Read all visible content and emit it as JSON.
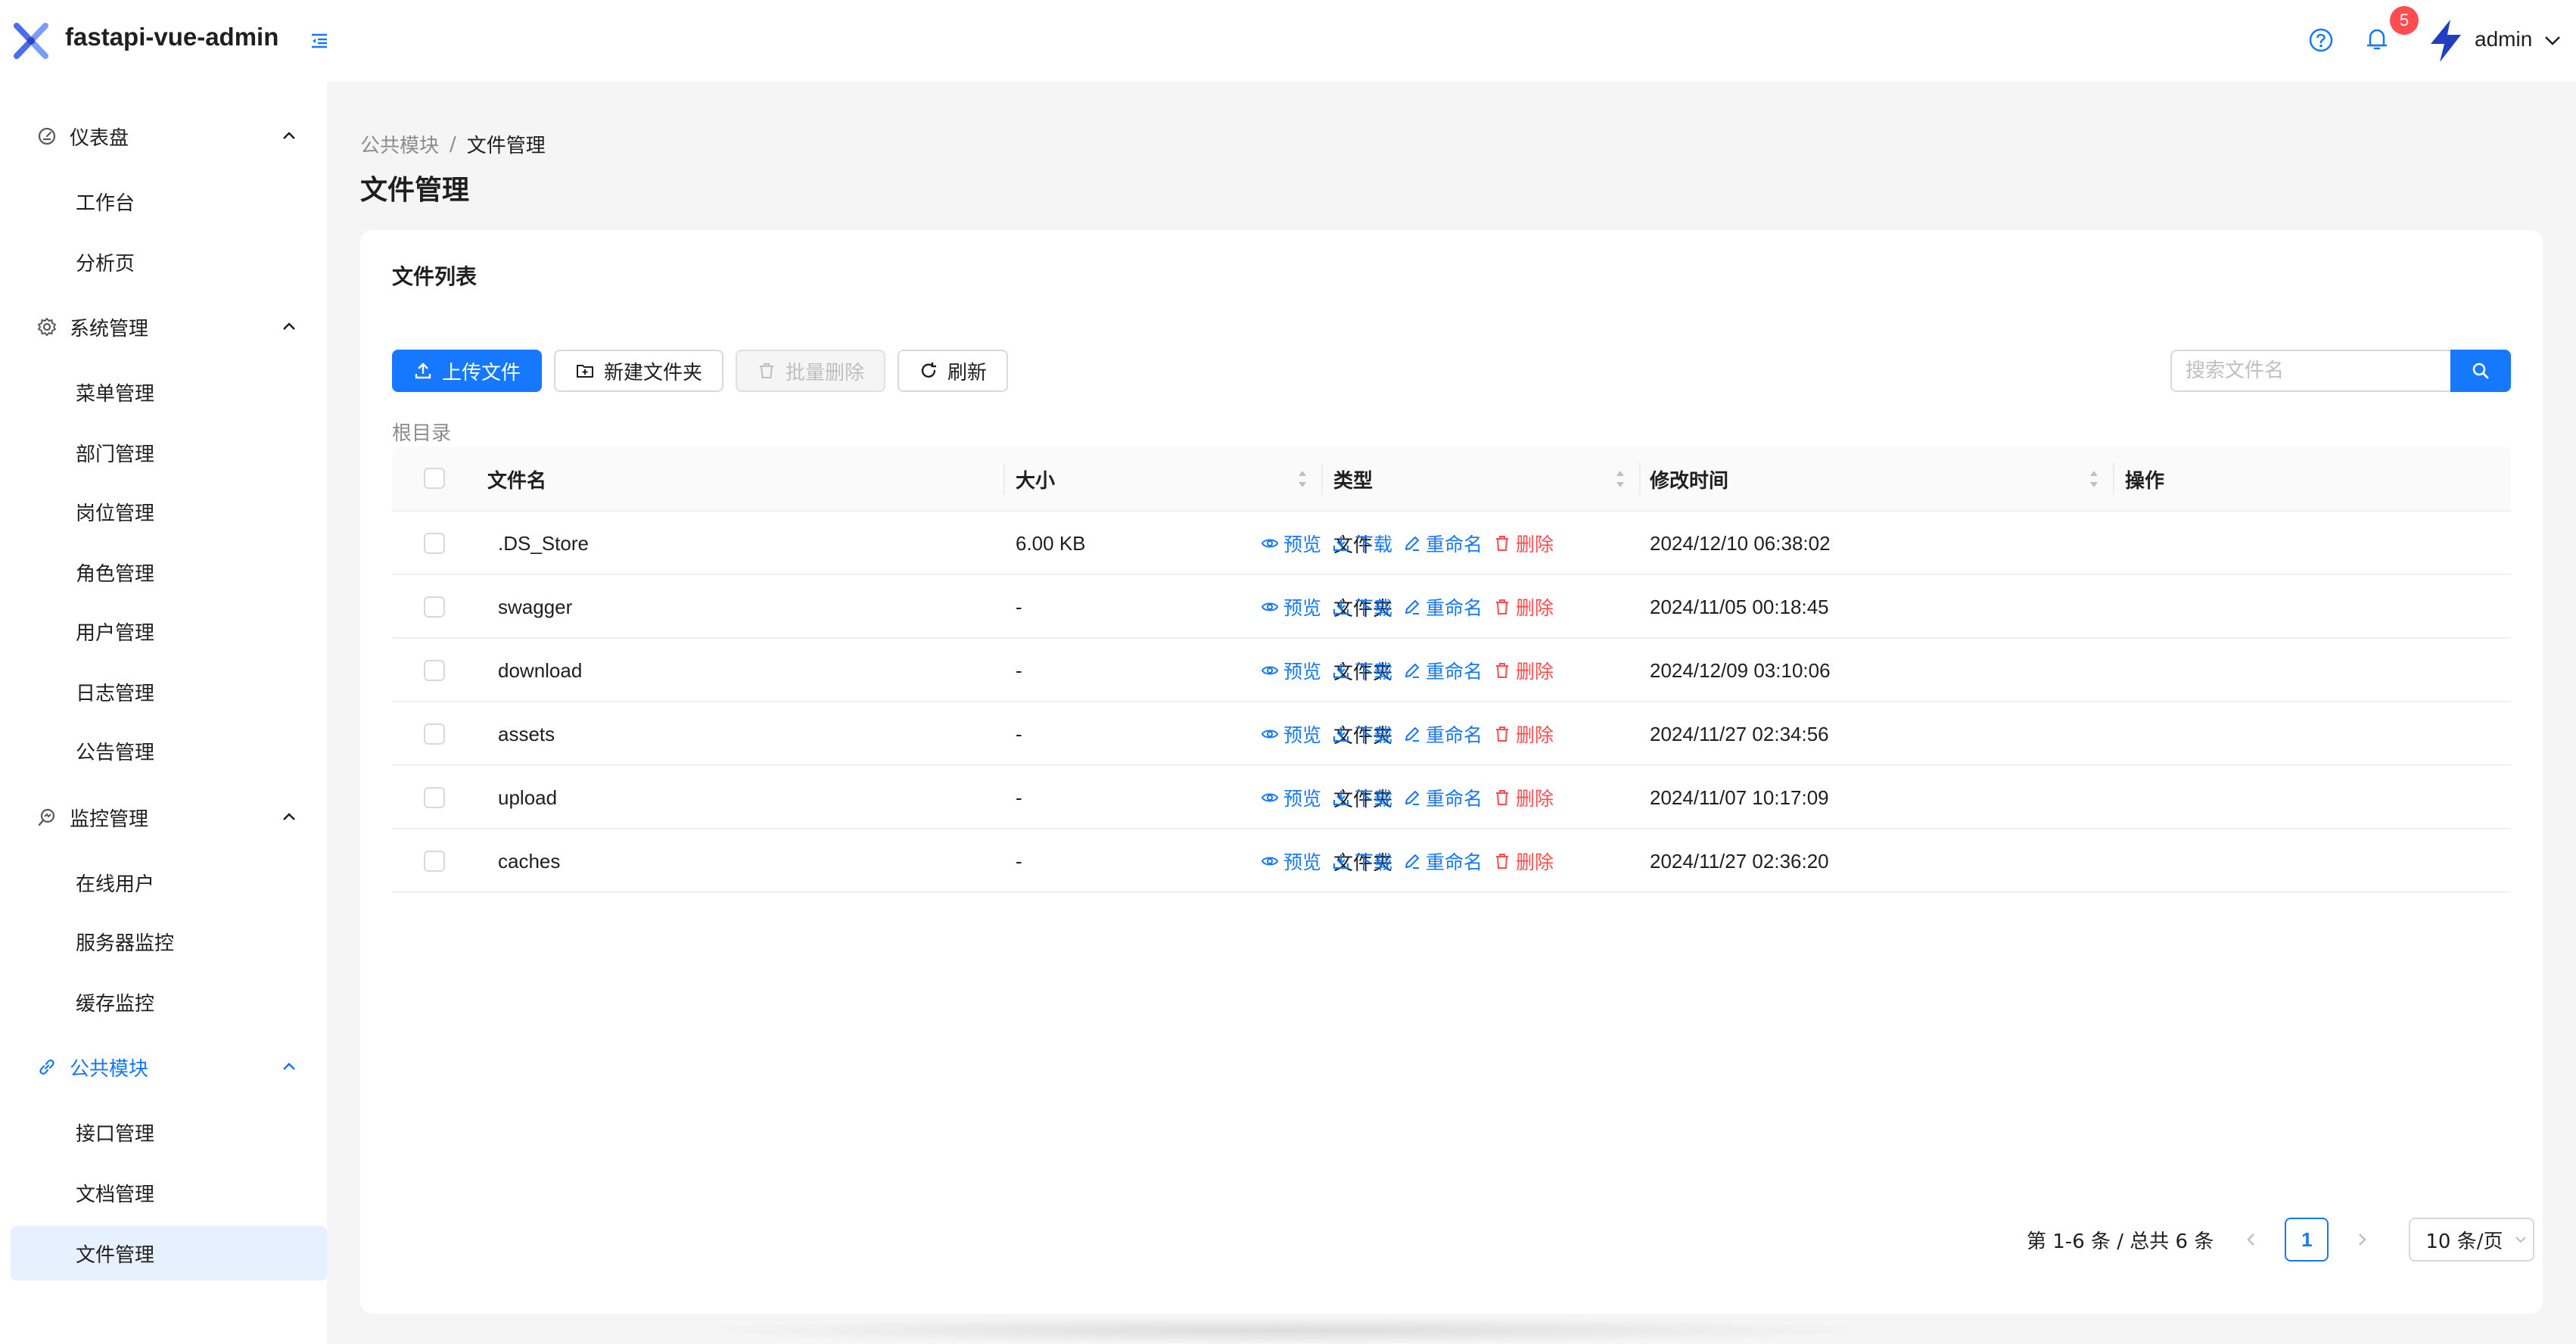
{
  "header": {
    "app_title": "fastapi-vue-admin",
    "notification_count": "5",
    "username": "admin"
  },
  "sidebar": {
    "groups": [
      {
        "label": "仪表盘",
        "icon": "dashboard-icon",
        "items": [
          "工作台",
          "分析页"
        ]
      },
      {
        "label": "系统管理",
        "icon": "gear-icon",
        "items": [
          "菜单管理",
          "部门管理",
          "岗位管理",
          "角色管理",
          "用户管理",
          "日志管理",
          "公告管理"
        ]
      },
      {
        "label": "监控管理",
        "icon": "monitor-icon",
        "items": [
          "在线用户",
          "服务器监控",
          "缓存监控"
        ]
      },
      {
        "label": "公共模块",
        "icon": "link-icon",
        "items": [
          "接口管理",
          "文档管理",
          "文件管理"
        ]
      }
    ],
    "active_group": "公共模块",
    "selected_item": "文件管理"
  },
  "breadcrumb": {
    "parent": "公共模块",
    "sep": "/",
    "current": "文件管理"
  },
  "page_title": "文件管理",
  "card": {
    "title": "文件列表",
    "toolbar": {
      "upload": "上传文件",
      "new_folder": "新建文件夹",
      "batch_delete": "批量删除",
      "refresh": "刷新"
    },
    "search_placeholder": "搜索文件名",
    "current_dir": "根目录"
  },
  "table": {
    "columns": [
      "文件名",
      "大小",
      "类型",
      "修改时间",
      "操作"
    ],
    "rows": [
      {
        "name": ".DS_Store",
        "size": "6.00 KB",
        "type": "文件",
        "modified": "2024/12/10 06:38:02"
      },
      {
        "name": "swagger",
        "size": "-",
        "type": "文件夹",
        "modified": "2024/11/05 00:18:45"
      },
      {
        "name": "download",
        "size": "-",
        "type": "文件夹",
        "modified": "2024/12/09 03:10:06"
      },
      {
        "name": "assets",
        "size": "-",
        "type": "文件夹",
        "modified": "2024/11/27 02:34:56"
      },
      {
        "name": "upload",
        "size": "-",
        "type": "文件夹",
        "modified": "2024/11/07 10:17:09"
      },
      {
        "name": "caches",
        "size": "-",
        "type": "文件夹",
        "modified": "2024/11/27 02:36:20"
      }
    ],
    "actions": {
      "preview": "预览",
      "download": "下载",
      "rename": "重命名",
      "delete": "删除"
    }
  },
  "pagination": {
    "total_text": "第 1-6 条 / 总共 6 条",
    "current_page": "1",
    "page_size": "10 条/页"
  },
  "colors": {
    "primary": "#1677ff",
    "danger": "#ff4d4f",
    "selected_bg": "#e6f0ff"
  }
}
